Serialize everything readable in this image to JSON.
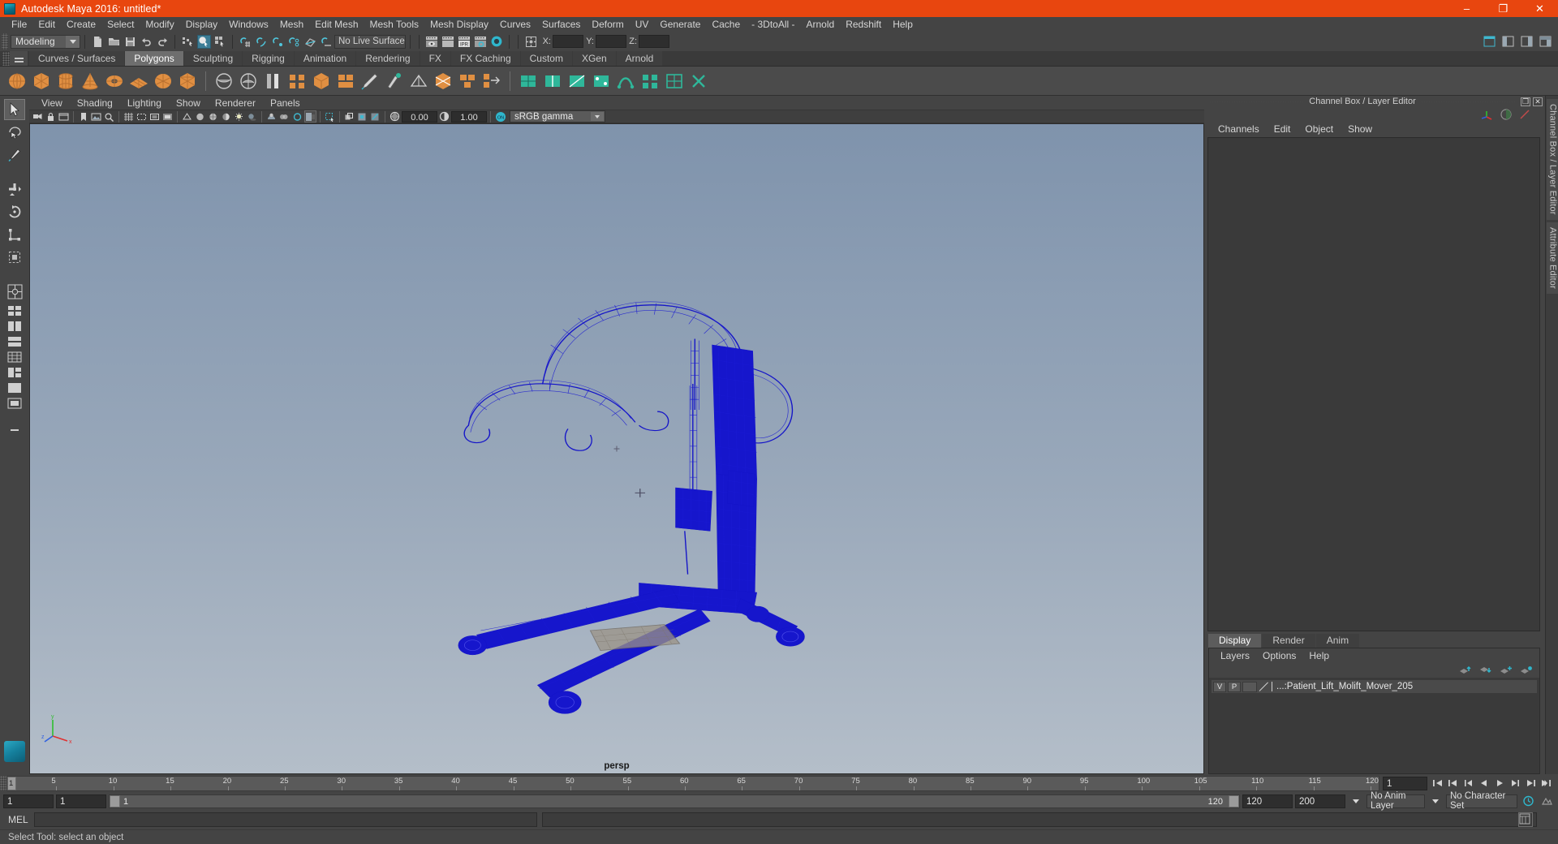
{
  "window": {
    "title": "Autodesk Maya 2016: untitled*",
    "app_icon": "maya-app-icon",
    "minimize": "–",
    "maximize": "❐",
    "close": "✕",
    "titlebar_color": "#e8460f"
  },
  "menubar": {
    "items": [
      "File",
      "Edit",
      "Create",
      "Select",
      "Modify",
      "Display",
      "Windows",
      "Mesh",
      "Edit Mesh",
      "Mesh Tools",
      "Mesh Display",
      "Curves",
      "Surfaces",
      "Deform",
      "UV",
      "Generate",
      "Cache",
      "- 3DtoAll -",
      "Arnold",
      "Redshift",
      "Help"
    ]
  },
  "toolbar": {
    "menuset": "Modeling",
    "live_surface": "No Live Surface",
    "axis_labels": [
      "X:",
      "Y:",
      "Z:"
    ],
    "axis_values": [
      "",
      "",
      ""
    ],
    "icons": [
      "new-scene-icon",
      "open-scene-icon",
      "save-scene-icon",
      "undo-icon",
      "redo-icon",
      "select-by-hierarchy-icon",
      "select-by-object-icon",
      "select-by-component-icon",
      "snap-to-grid-icon",
      "snap-to-curve-icon",
      "snap-to-point-icon",
      "snap-to-projected-center-icon",
      "snap-to-view-plane-icon",
      "make-live-icon",
      "render-current-frame-icon",
      "render-sequence-icon",
      "ipr-render-icon",
      "render-settings-icon",
      "hypershade-icon",
      "editor-layout-icon"
    ],
    "right_icons": [
      "show-hide-ui-icon",
      "outliner-toggle-icon",
      "attribute-editor-toggle-icon",
      "channel-box-toggle-icon"
    ]
  },
  "shelf": {
    "tabs": [
      "Curves / Surfaces",
      "Polygons",
      "Sculpting",
      "Rigging",
      "Animation",
      "Rendering",
      "FX",
      "FX Caching",
      "Custom",
      "XGen",
      "Arnold"
    ],
    "active_tab": "Polygons",
    "icons": [
      "poly-sphere-icon",
      "poly-cube-icon",
      "poly-cylinder-icon",
      "poly-cone-icon",
      "poly-torus-icon",
      "poly-plane-icon",
      "poly-disc-icon",
      "poly-platonic-icon",
      "poly-combine-icon",
      "poly-separate-icon",
      "poly-extrude-icon",
      "poly-bridge-icon",
      "poly-bevel-icon",
      "poly-booleans-icon",
      "poly-smooth-icon",
      "poly-append-icon",
      "poly-quad-draw-icon",
      "poly-multicut-icon",
      "poly-target-weld-icon",
      "poly-connect-icon",
      "poly-crease-icon",
      "poly-uv-icon",
      "poly-cut-uv-icon",
      "poly-sew-uv-icon",
      "poly-unfold-uv-icon",
      "poly-layout-uv-icon",
      "uv-editor-icon",
      "uv-snapshot-icon",
      "sculpt-tool-icon",
      "poly-mirror-icon",
      "poly-reduce-icon",
      "poly-triangulate-icon",
      "poly-transfer-attributes-icon",
      "poly-cleanup-icon"
    ]
  },
  "toolbox": {
    "items": [
      {
        "name": "select-tool",
        "selected": true
      },
      {
        "name": "lasso-select-tool",
        "selected": false
      },
      {
        "name": "paint-select-tool",
        "selected": false
      },
      {
        "name": "move-tool",
        "selected": false
      },
      {
        "name": "rotate-tool",
        "selected": false
      },
      {
        "name": "scale-tool",
        "selected": false
      },
      {
        "name": "last-tool-used",
        "selected": false
      }
    ],
    "layout_items": [
      "single-perspective-layout",
      "four-view-layout",
      "persp-outliner-layout",
      "persp-graph-layout",
      "two-pane-stacked-layout",
      "hypershade-layout",
      "persp-uv-layout",
      "render-view-layout"
    ],
    "bottom_icon": "maya-cube-logo"
  },
  "viewport": {
    "panel_menu": [
      "View",
      "Shading",
      "Lighting",
      "Show",
      "Renderer",
      "Panels"
    ],
    "camera_label": "persp",
    "exposure_value": "0.00",
    "gamma_value": "1.00",
    "color_management": "sRGB gamma",
    "color_management_on": "ON",
    "axis_gizmo": {
      "x": "x",
      "y": "y",
      "z": "z",
      "x_color": "#e03030",
      "y_color": "#2fbf2f",
      "z_color": "#3060e0"
    },
    "background_top": "#7f93ac",
    "background_bottom": "#b4bec9",
    "model_color": "#1414c8",
    "model_name": "Patient_Lift_Molift_Mover_205",
    "toolbar_icons": [
      "select-camera-icon",
      "lock-camera-icon",
      "camera-attributes-icon",
      "bookmark-icon",
      "image-plane-icon",
      "2d-pan-zoom-icon",
      "grid-toggle-icon",
      "film-gate-icon",
      "resolution-gate-icon",
      "gate-mask-icon",
      "wireframe-icon",
      "smooth-shade-icon",
      "shaded-wireframe-icon",
      "textured-icon",
      "lights-icon",
      "shadows-icon",
      "screen-space-ao-icon",
      "motion-blur-icon",
      "multisample-icon",
      "depth-of-field-icon",
      "isolate-select-icon",
      "xray-icon",
      "xray-joints-icon",
      "xray-active-components-icon",
      "exposure-icon",
      "gamma-icon"
    ]
  },
  "channel_box": {
    "panel_title": "Channel Box / Layer Editor",
    "restore_glyph": "❐",
    "close_glyph": "✕",
    "menu": [
      "Channels",
      "Edit",
      "Object",
      "Show"
    ],
    "icons": [
      "axis-gizmo-icon",
      "shading-sphere-icon",
      "red-slash-icon"
    ],
    "empty": ""
  },
  "layer_editor": {
    "tabs": [
      "Display",
      "Render",
      "Anim"
    ],
    "active_tab": "Display",
    "menu": [
      "Layers",
      "Options",
      "Help"
    ],
    "buttons": [
      "move-layer-up-icon",
      "move-layer-down-icon",
      "new-layer-icon",
      "new-layer-from-selected-icon"
    ],
    "layers": [
      {
        "visibility": "V",
        "playback": "P",
        "color": "",
        "name": "...:Patient_Lift_Molift_Mover_205"
      }
    ]
  },
  "vertical_tabs": [
    "Channel Box / Layer Editor",
    "Attribute Editor"
  ],
  "time_slider": {
    "current_frame": "1",
    "ticks": [
      "5",
      "10",
      "15",
      "20",
      "25",
      "30",
      "35",
      "40",
      "45",
      "50",
      "55",
      "60",
      "65",
      "70",
      "75",
      "80",
      "85",
      "90",
      "95",
      "100",
      "105",
      "110",
      "115",
      "120"
    ],
    "start": 1,
    "end": 120,
    "frame_field": "1",
    "transport_icons": [
      "go-to-start-icon",
      "step-back-key-icon",
      "step-back-frame-icon",
      "play-backwards-icon",
      "play-forwards-icon",
      "step-forward-frame-icon",
      "step-forward-key-icon",
      "go-to-end-icon"
    ]
  },
  "range_slider": {
    "anim_start": "1",
    "range_start": "1",
    "slider_left_label": "1",
    "slider_right_label": "120",
    "range_end": "120",
    "anim_end": "200",
    "anim_layer": "No Anim Layer",
    "character_set": "No Character Set",
    "auto_key_icon": "auto-keyframe-icon",
    "anim_prefs_icon": "animation-preferences-icon"
  },
  "command_line": {
    "language": "MEL",
    "input_value": "",
    "output_value": "",
    "script_editor_icon": "script-editor-icon"
  },
  "status_line": {
    "message": "Select Tool: select an object"
  }
}
